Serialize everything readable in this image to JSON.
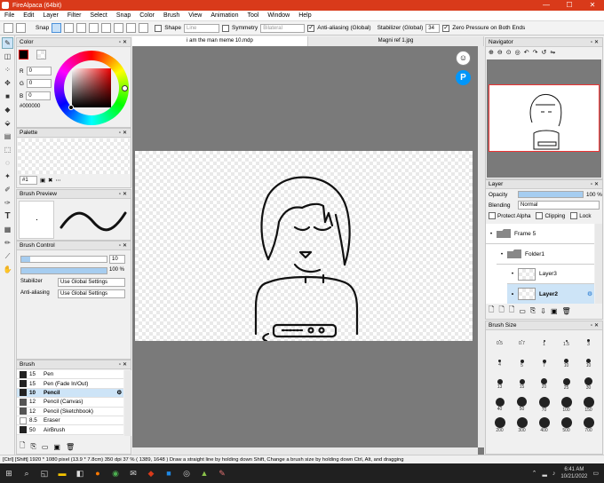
{
  "window": {
    "title": "FireAlpaca (64bit)",
    "controls": [
      "—",
      "☐",
      "✕"
    ]
  },
  "menu": [
    "File",
    "Edit",
    "Layer",
    "Filter",
    "Select",
    "Snap",
    "Color",
    "Brush",
    "View",
    "Animation",
    "Tool",
    "Window",
    "Help"
  ],
  "tool_options": {
    "snap_label": "Snap",
    "shape_label": "Shape",
    "shape_value": "Line",
    "symmetry_label": "Symmetry",
    "symmetry_value": "Bilateral",
    "antialias_label": "Anti-aliasing (Global)",
    "stabilizer_label": "Stabilizer (Global)",
    "stabilizer_value": "34",
    "zero_pressure_label": "Zero Pressure on Both Ends"
  },
  "color_panel": {
    "title": "Color",
    "r_label": "R",
    "r": "0",
    "g_label": "G",
    "g": "0",
    "b_label": "B",
    "b": "0",
    "hex": "#000000"
  },
  "palette_panel": {
    "title": "Palette",
    "selector": "#1"
  },
  "brush_preview": {
    "title": "Brush Preview"
  },
  "brush_control": {
    "title": "Brush Control",
    "size": "10",
    "opacity": "100 %",
    "size_fill": 0.1,
    "opacity_fill": 1.0,
    "stabilizer_label": "Stabilizer",
    "stabilizer_value": "Use Global Settings",
    "antialias_label": "Anti-aliasing",
    "antialias_value": "Use Global Settings"
  },
  "brush_list": {
    "title": "Brush",
    "items": [
      {
        "size": "15",
        "name": "Pen"
      },
      {
        "size": "15",
        "name": "Pen (Fade In/Out)"
      },
      {
        "size": "10",
        "name": "Pencil"
      },
      {
        "size": "12",
        "name": "Pencil (Canvas)"
      },
      {
        "size": "12",
        "name": "Pencil (Sketchbook)"
      },
      {
        "size": "8.5",
        "name": "Eraser"
      },
      {
        "size": "50",
        "name": "AirBrush"
      }
    ],
    "selected_index": 2
  },
  "tabs": [
    "i am the man meme 10.mdp",
    "Magni ref 1.jpg"
  ],
  "navigator": {
    "title": "Navigator"
  },
  "layer_panel": {
    "title": "Layer",
    "opacity_label": "Opacity",
    "opacity_value": "100 %",
    "opacity_fill": 1.0,
    "blending_label": "Blending",
    "blending_value": "Normal",
    "protect_alpha": "Protect Alpha",
    "clipping": "Clipping",
    "lock": "Lock",
    "layers": [
      {
        "name": "Frame 5",
        "type": "folder"
      },
      {
        "name": "Folder1",
        "type": "folder"
      },
      {
        "name": "Layer3",
        "type": "layer"
      },
      {
        "name": "Layer2",
        "type": "layer",
        "selected": true
      }
    ]
  },
  "brush_size": {
    "title": "Brush Size",
    "sizes": [
      "0.5",
      "0.7",
      "1",
      "1.5",
      "3",
      "4",
      "5",
      "7",
      "10",
      "10",
      "13",
      "15",
      "20",
      "25",
      "30",
      "40",
      "50",
      "70",
      "100",
      "150",
      "200",
      "300",
      "400",
      "500",
      "700"
    ]
  },
  "status": "[Ctrl] [Shift]   1920 * 1080 pixel   (13.9 * 7.8cm)   350 dpi   37 %   ( 1389, 1648 )   Draw a straight line by holding down Shift, Change a brush size by holding down Ctrl, Alt, and dragging",
  "taskbar": {
    "time": "6:41 AM",
    "date": "10/21/2022",
    "search_icon": "search-icon"
  },
  "colors": {
    "titlebar": "#d93a1a",
    "selection": "#cde4f7",
    "canvas_bg": "#7a7a7a"
  }
}
